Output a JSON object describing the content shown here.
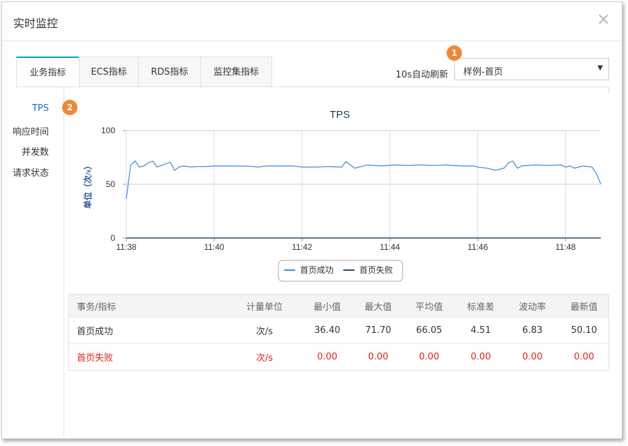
{
  "dialog": {
    "title": "实时监控",
    "close": "×"
  },
  "tabs": [
    {
      "label": "业务指标",
      "active": true
    },
    {
      "label": "ECS指标",
      "active": false
    },
    {
      "label": "RDS指标",
      "active": false
    },
    {
      "label": "监控集指标",
      "active": false
    }
  ],
  "refresh": {
    "label": "10s自动刷新",
    "selected": "样例-首页",
    "caret": "▼"
  },
  "badges": {
    "one": "1",
    "two": "2"
  },
  "sidebar": {
    "items": [
      "TPS",
      "响应时间",
      "并发数",
      "请求状态"
    ]
  },
  "colors": {
    "accent": "#00a2ca",
    "series_success": "#4a90e2",
    "series_fail": "#2d4a6b",
    "fail_text": "#e5201f",
    "badge": "#ee8836"
  },
  "chart_data": {
    "type": "line",
    "title": "TPS",
    "ylabel": "单位（次/s）",
    "xlabel": "",
    "ylim": [
      0,
      100
    ],
    "yticks": [
      "0",
      "50",
      "100"
    ],
    "xticks": [
      "11:38",
      "11:40",
      "11:42",
      "11:44",
      "11:46",
      "11:48"
    ],
    "x_range_min": [
      0,
      10.8
    ],
    "legend_position": "bottom",
    "grid": true,
    "series": [
      {
        "name": "首页成功",
        "x": [
          0,
          0.1,
          0.2,
          0.3,
          0.4,
          0.5,
          0.6,
          0.7,
          0.8,
          0.9,
          1.0,
          1.1,
          1.2,
          1.3,
          1.4,
          1.5,
          1.6,
          1.8,
          2.0,
          2.2,
          2.5,
          2.8,
          3.0,
          3.2,
          3.5,
          3.8,
          4.0,
          4.3,
          4.6,
          4.9,
          5.0,
          5.2,
          5.3,
          5.5,
          5.8,
          6.1,
          6.4,
          6.7,
          7.0,
          7.3,
          7.6,
          7.9,
          8.0,
          8.2,
          8.4,
          8.6,
          8.7,
          8.8,
          8.9,
          9.0,
          9.3,
          9.6,
          9.9,
          10.0,
          10.1,
          10.2,
          10.4,
          10.6,
          10.7,
          10.8
        ],
        "values": [
          36.4,
          68,
          71.7,
          66,
          67,
          70,
          71.5,
          66,
          67.5,
          69,
          70.5,
          63,
          66,
          67,
          66.5,
          66,
          66.5,
          66.5,
          67,
          67,
          67,
          66.8,
          66,
          67,
          67,
          67,
          66,
          66,
          66.5,
          66,
          71,
          65,
          66,
          68,
          67,
          68,
          67.5,
          68,
          67.5,
          68,
          67,
          67,
          66,
          65,
          63,
          65,
          70,
          71.5,
          65,
          67,
          68,
          67.5,
          68,
          66,
          67,
          65,
          67,
          66,
          60,
          50.1
        ]
      },
      {
        "name": "首页失败",
        "x": [
          0,
          10.8
        ],
        "values": [
          0,
          0
        ]
      }
    ]
  },
  "table": {
    "headers": [
      "事务/指标",
      "计量单位",
      "最小值",
      "最大值",
      "平均值",
      "标准差",
      "波动率",
      "最新值"
    ],
    "rows": [
      {
        "name": "首页成功",
        "unit": "次/s",
        "min": "36.40",
        "max": "71.70",
        "avg": "66.05",
        "std": "4.51",
        "vol": "6.83",
        "last": "50.10"
      },
      {
        "name": "首页失败",
        "unit": "次/s",
        "min": "0.00",
        "max": "0.00",
        "avg": "0.00",
        "std": "0.00",
        "vol": "0.00",
        "last": "0.00"
      }
    ]
  }
}
